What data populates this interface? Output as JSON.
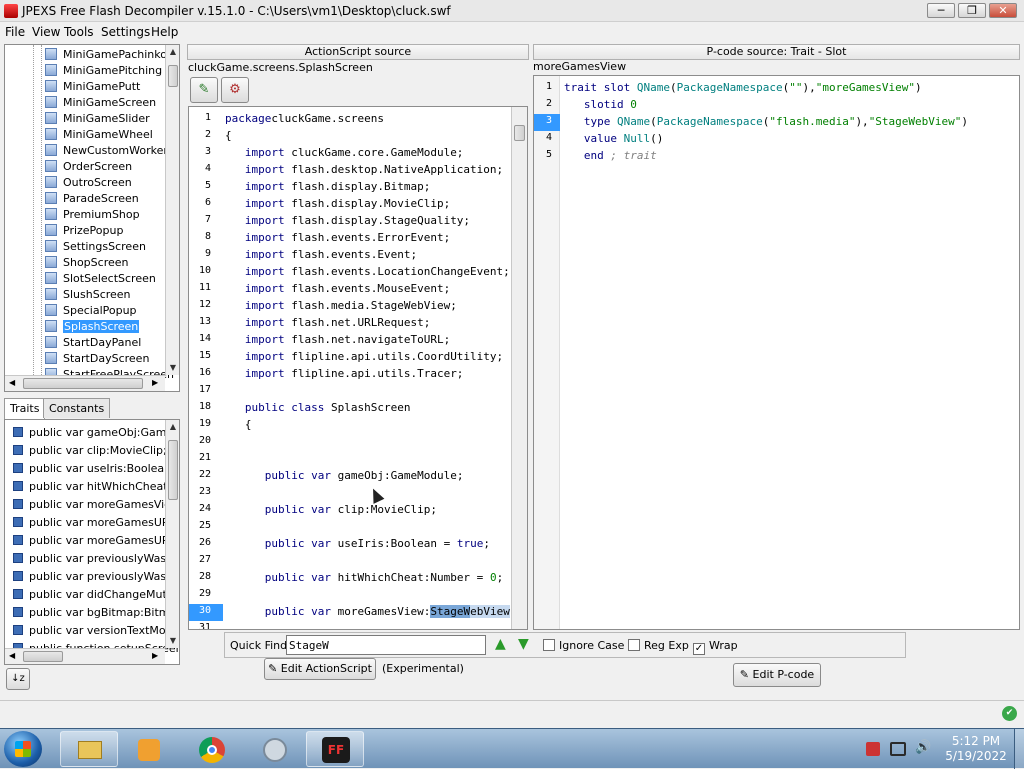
{
  "window": {
    "title": "JPEXS Free Flash Decompiler v.15.1.0 - C:\\Users\\vm1\\Desktop\\cluck.swf",
    "min": "─",
    "max": "❐",
    "close": "✕"
  },
  "menu": [
    "File",
    "View",
    "Tools",
    "Settings",
    "Help"
  ],
  "tree": {
    "items": [
      "MiniGamePachinko",
      "MiniGamePitching",
      "MiniGamePutt",
      "MiniGameScreen",
      "MiniGameSlider",
      "MiniGameWheel",
      "NewCustomWorkerSc",
      "OrderScreen",
      "OutroScreen",
      "ParadeScreen",
      "PremiumShop",
      "PrizePopup",
      "SettingsScreen",
      "ShopScreen",
      "SlotSelectScreen",
      "SlushScreen",
      "SpecialPopup",
      "SplashScreen",
      "StartDayPanel",
      "StartDayScreen",
      "StartFreePlayScreen"
    ],
    "selected": "SplashScreen"
  },
  "traits_tabs": [
    "Traits",
    "Constants"
  ],
  "traits": [
    "public var gameObj:GameMo",
    "public var clip:MovieClip;",
    "public var useIris:Boolean =",
    "public var hitWhichCheat:Nu",
    "public var moreGamesView:S",
    "public var moreGamesURLPh",
    "public var moreGamesURLTa",
    "public var previouslyWasMu",
    "public var previouslyWasMu",
    "public var didChangeMuting",
    "public var bgBitmap:Bitmap",
    "public var versionTextMode",
    "public function setupScreen"
  ],
  "as": {
    "header": "ActionScript source",
    "path": "cluckGame.screens.SplashScreen",
    "line_numbers": [
      "1",
      "2",
      "3",
      "4",
      "5",
      "6",
      "7",
      "8",
      "9",
      "10",
      "11",
      "12",
      "13",
      "14",
      "15",
      "16",
      "17",
      "18",
      "19",
      "20",
      "21",
      "22",
      "23",
      "24",
      "25",
      "26",
      "27",
      "28",
      "29",
      "30",
      "31"
    ],
    "lines": [
      [
        [
          "kw",
          "package"
        ],
        [
          "",
          "cluckGame.screens"
        ]
      ],
      [
        [
          "",
          "{"
        ]
      ],
      [
        [
          "",
          "   "
        ],
        [
          "kw",
          "import"
        ],
        [
          "",
          " cluckGame.core.GameModule;"
        ]
      ],
      [
        [
          "",
          "   "
        ],
        [
          "kw",
          "import"
        ],
        [
          "",
          " flash.desktop.NativeApplication;"
        ]
      ],
      [
        [
          "",
          "   "
        ],
        [
          "kw",
          "import"
        ],
        [
          "",
          " flash.display.Bitmap;"
        ]
      ],
      [
        [
          "",
          "   "
        ],
        [
          "kw",
          "import"
        ],
        [
          "",
          " flash.display.MovieClip;"
        ]
      ],
      [
        [
          "",
          "   "
        ],
        [
          "kw",
          "import"
        ],
        [
          "",
          " flash.display.StageQuality;"
        ]
      ],
      [
        [
          "",
          "   "
        ],
        [
          "kw",
          "import"
        ],
        [
          "",
          " flash.events.ErrorEvent;"
        ]
      ],
      [
        [
          "",
          "   "
        ],
        [
          "kw",
          "import"
        ],
        [
          "",
          " flash.events.Event;"
        ]
      ],
      [
        [
          "",
          "   "
        ],
        [
          "kw",
          "import"
        ],
        [
          "",
          " flash.events.LocationChangeEvent;"
        ]
      ],
      [
        [
          "",
          "   "
        ],
        [
          "kw",
          "import"
        ],
        [
          "",
          " flash.events.MouseEvent;"
        ]
      ],
      [
        [
          "",
          "   "
        ],
        [
          "kw",
          "import"
        ],
        [
          "",
          " flash.media.StageWebView;"
        ]
      ],
      [
        [
          "",
          "   "
        ],
        [
          "kw",
          "import"
        ],
        [
          "",
          " flash.net.URLRequest;"
        ]
      ],
      [
        [
          "",
          "   "
        ],
        [
          "kw",
          "import"
        ],
        [
          "",
          " flash.net.navigateToURL;"
        ]
      ],
      [
        [
          "",
          "   "
        ],
        [
          "kw",
          "import"
        ],
        [
          "",
          " flipline.api.utils.CoordUtility;"
        ]
      ],
      [
        [
          "",
          "   "
        ],
        [
          "kw",
          "import"
        ],
        [
          "",
          " flipline.api.utils.Tracer;"
        ]
      ],
      [],
      [
        [
          "",
          "   "
        ],
        [
          "kw",
          "public class"
        ],
        [
          "",
          " SplashScreen"
        ]
      ],
      [
        [
          "",
          "   {"
        ]
      ],
      [],
      [],
      [
        [
          "",
          "      "
        ],
        [
          "kw",
          "public var"
        ],
        [
          "",
          " gameObj:GameModule;"
        ]
      ],
      [],
      [
        [
          "",
          "      "
        ],
        [
          "kw",
          "public var"
        ],
        [
          "",
          " clip:MovieClip;"
        ]
      ],
      [],
      [
        [
          "",
          "      "
        ],
        [
          "kw",
          "public var"
        ],
        [
          "",
          " useIris:Boolean = "
        ],
        [
          "kw",
          "true"
        ],
        [
          "",
          ";"
        ]
      ],
      [],
      [
        [
          "",
          "      "
        ],
        [
          "kw",
          "public var"
        ],
        [
          "",
          " hitWhichCheat:Number = "
        ],
        [
          "num",
          "0"
        ],
        [
          "",
          ";"
        ]
      ],
      [],
      [
        [
          "",
          "      "
        ],
        [
          "kw",
          "public var"
        ],
        [
          "",
          " moreGamesView:"
        ],
        [
          "hl",
          "StageW"
        ],
        [
          "hl2",
          "ebView"
        ],
        [
          "",
          ";"
        ]
      ],
      []
    ],
    "edit_label": "Edit ActionScript",
    "experimental": "(Experimental)"
  },
  "find": {
    "label": "Quick Find",
    "value": "StageW",
    "ignore_case": "Ignore Case",
    "regexp": "Reg Exp",
    "wrap": "Wrap",
    "wrap_checked": "✓"
  },
  "pcode": {
    "header": "P-code source: Trait - Slot",
    "path": "moreGamesView",
    "line_numbers": [
      "1",
      "2",
      "3",
      "4",
      "5"
    ],
    "lines": [
      [
        [
          "kw",
          "trait slot "
        ],
        [
          "ty",
          "QName"
        ],
        [
          "",
          "("
        ],
        [
          "ty",
          "PackageNamespace"
        ],
        [
          "",
          "("
        ],
        [
          "str",
          "\"\""
        ],
        [
          "",
          "),"
        ],
        [
          "str",
          "\"moreGamesView\""
        ],
        [
          "",
          ")"
        ]
      ],
      [
        [
          "",
          "   "
        ],
        [
          "kw",
          "slotid "
        ],
        [
          "num",
          "0"
        ]
      ],
      [
        [
          "",
          "   "
        ],
        [
          "kw",
          "type "
        ],
        [
          "ty",
          "QName"
        ],
        [
          "",
          "("
        ],
        [
          "ty",
          "PackageNamespace"
        ],
        [
          "",
          "("
        ],
        [
          "str",
          "\"flash.media\""
        ],
        [
          "",
          "),"
        ],
        [
          "str",
          "\"StageWebView\""
        ],
        [
          "",
          ")"
        ]
      ],
      [
        [
          "",
          "   "
        ],
        [
          "kw",
          "value "
        ],
        [
          "ty",
          "Null"
        ],
        [
          "",
          "()"
        ]
      ],
      [
        [
          "",
          "   "
        ],
        [
          "kw",
          "end "
        ],
        [
          "cmt",
          "; trait"
        ]
      ]
    ],
    "edit_label": "Edit P-code"
  },
  "clock": {
    "time": "5:12 PM",
    "date": "5/19/2022"
  },
  "status": "✔"
}
